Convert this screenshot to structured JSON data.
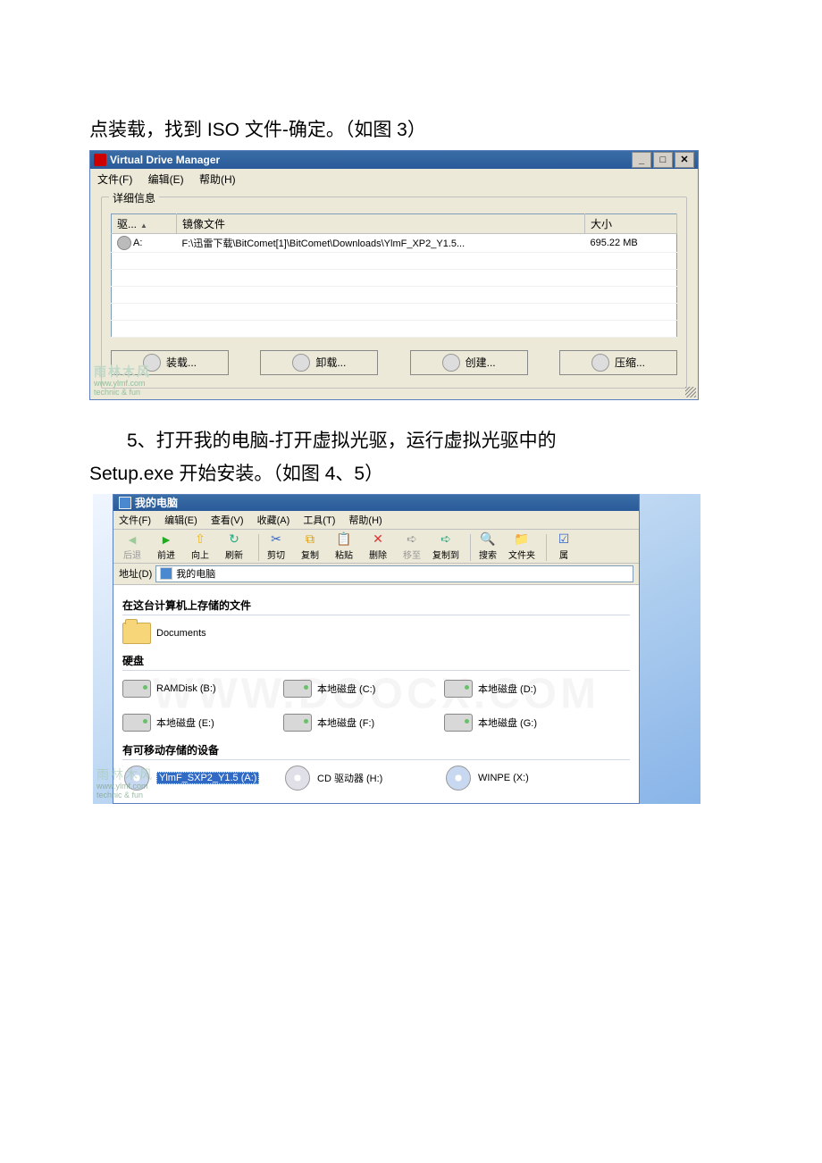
{
  "text": {
    "line1": "点装载，找到 ISO 文件-确定。（如图 3）",
    "line2": "5、打开我的电脑-打开虚拟光驱，运行虚拟光驱中的",
    "line3": "Setup.exe 开始安装。（如图 4、5）"
  },
  "vdm": {
    "title": "Virtual Drive Manager",
    "menu": {
      "file": "文件(F)",
      "edit": "编辑(E)",
      "help": "帮助(H)"
    },
    "section": "详细信息",
    "cols": {
      "drive": "驱...",
      "image": "镜像文件",
      "size": "大小"
    },
    "row": {
      "drive": "A:",
      "image": "F:\\迅雷下载\\BitComet[1]\\BitComet\\Downloads\\YlmF_XP2_Y1.5...",
      "size": "695.22 MB"
    },
    "buttons": {
      "mount": "装载...",
      "unmount": "卸载...",
      "create": "创建...",
      "compress": "压缩..."
    },
    "wm": {
      "brand": "雨林木风",
      "url": "www.ylmf.com",
      "tag": "technic & fun"
    }
  },
  "explorer": {
    "title": "我的电脑",
    "menu": {
      "file": "文件(F)",
      "edit": "编辑(E)",
      "view": "查看(V)",
      "fav": "收藏(A)",
      "tools": "工具(T)",
      "help": "帮助(H)"
    },
    "addr_label": "地址(D)",
    "addr_value": "我的电脑",
    "tb": {
      "back": "后退",
      "fwd": "前进",
      "up": "向上",
      "refresh": "刷新",
      "cut": "剪切",
      "copy": "复制",
      "paste": "粘贴",
      "delete": "删除",
      "moveto": "移至",
      "copyto": "复制到",
      "search": "搜索",
      "folders": "文件夹",
      "props": "属"
    },
    "sections": {
      "files": "在这台计算机上存储的文件",
      "hdd": "硬盘",
      "removable": "有可移动存储的设备"
    },
    "items": {
      "documents": "Documents",
      "ramdisk": "RAMDisk (B:)",
      "c": "本地磁盘 (C:)",
      "d": "本地磁盘 (D:)",
      "e": "本地磁盘 (E:)",
      "f": "本地磁盘 (F:)",
      "g": "本地磁盘 (G:)",
      "virtual": "YlmF_SXP2_Y1.5 (A:)",
      "cd": "CD 驱动器 (H:)",
      "winpe": "WINPE (X:)"
    },
    "wm_big": "WWW.DOOCX.COM",
    "wm": {
      "brand": "雨林木风",
      "url": "www.ylmf.com",
      "tag": "technic & fun"
    }
  }
}
